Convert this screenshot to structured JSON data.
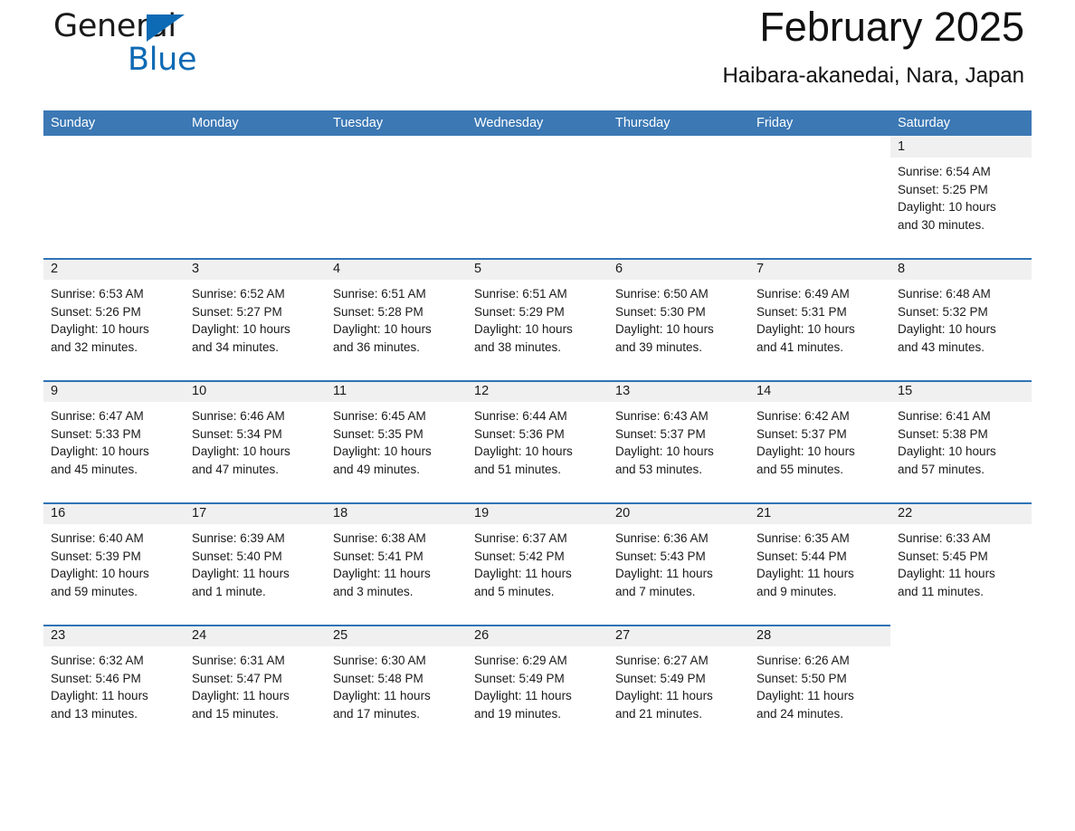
{
  "brand": {
    "word1": "General",
    "word2": "Blue",
    "triangle_color": "#0d6ab4"
  },
  "header": {
    "title": "February 2025",
    "location": "Haibara-akanedai, Nara, Japan"
  },
  "theme": {
    "header_row_bg": "#3b78b4",
    "rule_color": "#2f74b5",
    "date_bar_bg": "#f0f0f0",
    "text_color": "#1a1a1a"
  },
  "weekdays": [
    "Sunday",
    "Monday",
    "Tuesday",
    "Wednesday",
    "Thursday",
    "Friday",
    "Saturday"
  ],
  "weeks": [
    [
      {
        "blank": true
      },
      {
        "blank": true
      },
      {
        "blank": true
      },
      {
        "blank": true
      },
      {
        "blank": true
      },
      {
        "blank": true
      },
      {
        "day": "1",
        "sunrise": "Sunrise: 6:54 AM",
        "sunset": "Sunset: 5:25 PM",
        "daylight1": "Daylight: 10 hours",
        "daylight2": "and 30 minutes."
      }
    ],
    [
      {
        "day": "2",
        "sunrise": "Sunrise: 6:53 AM",
        "sunset": "Sunset: 5:26 PM",
        "daylight1": "Daylight: 10 hours",
        "daylight2": "and 32 minutes."
      },
      {
        "day": "3",
        "sunrise": "Sunrise: 6:52 AM",
        "sunset": "Sunset: 5:27 PM",
        "daylight1": "Daylight: 10 hours",
        "daylight2": "and 34 minutes."
      },
      {
        "day": "4",
        "sunrise": "Sunrise: 6:51 AM",
        "sunset": "Sunset: 5:28 PM",
        "daylight1": "Daylight: 10 hours",
        "daylight2": "and 36 minutes."
      },
      {
        "day": "5",
        "sunrise": "Sunrise: 6:51 AM",
        "sunset": "Sunset: 5:29 PM",
        "daylight1": "Daylight: 10 hours",
        "daylight2": "and 38 minutes."
      },
      {
        "day": "6",
        "sunrise": "Sunrise: 6:50 AM",
        "sunset": "Sunset: 5:30 PM",
        "daylight1": "Daylight: 10 hours",
        "daylight2": "and 39 minutes."
      },
      {
        "day": "7",
        "sunrise": "Sunrise: 6:49 AM",
        "sunset": "Sunset: 5:31 PM",
        "daylight1": "Daylight: 10 hours",
        "daylight2": "and 41 minutes."
      },
      {
        "day": "8",
        "sunrise": "Sunrise: 6:48 AM",
        "sunset": "Sunset: 5:32 PM",
        "daylight1": "Daylight: 10 hours",
        "daylight2": "and 43 minutes."
      }
    ],
    [
      {
        "day": "9",
        "sunrise": "Sunrise: 6:47 AM",
        "sunset": "Sunset: 5:33 PM",
        "daylight1": "Daylight: 10 hours",
        "daylight2": "and 45 minutes."
      },
      {
        "day": "10",
        "sunrise": "Sunrise: 6:46 AM",
        "sunset": "Sunset: 5:34 PM",
        "daylight1": "Daylight: 10 hours",
        "daylight2": "and 47 minutes."
      },
      {
        "day": "11",
        "sunrise": "Sunrise: 6:45 AM",
        "sunset": "Sunset: 5:35 PM",
        "daylight1": "Daylight: 10 hours",
        "daylight2": "and 49 minutes."
      },
      {
        "day": "12",
        "sunrise": "Sunrise: 6:44 AM",
        "sunset": "Sunset: 5:36 PM",
        "daylight1": "Daylight: 10 hours",
        "daylight2": "and 51 minutes."
      },
      {
        "day": "13",
        "sunrise": "Sunrise: 6:43 AM",
        "sunset": "Sunset: 5:37 PM",
        "daylight1": "Daylight: 10 hours",
        "daylight2": "and 53 minutes."
      },
      {
        "day": "14",
        "sunrise": "Sunrise: 6:42 AM",
        "sunset": "Sunset: 5:37 PM",
        "daylight1": "Daylight: 10 hours",
        "daylight2": "and 55 minutes."
      },
      {
        "day": "15",
        "sunrise": "Sunrise: 6:41 AM",
        "sunset": "Sunset: 5:38 PM",
        "daylight1": "Daylight: 10 hours",
        "daylight2": "and 57 minutes."
      }
    ],
    [
      {
        "day": "16",
        "sunrise": "Sunrise: 6:40 AM",
        "sunset": "Sunset: 5:39 PM",
        "daylight1": "Daylight: 10 hours",
        "daylight2": "and 59 minutes."
      },
      {
        "day": "17",
        "sunrise": "Sunrise: 6:39 AM",
        "sunset": "Sunset: 5:40 PM",
        "daylight1": "Daylight: 11 hours",
        "daylight2": "and 1 minute."
      },
      {
        "day": "18",
        "sunrise": "Sunrise: 6:38 AM",
        "sunset": "Sunset: 5:41 PM",
        "daylight1": "Daylight: 11 hours",
        "daylight2": "and 3 minutes."
      },
      {
        "day": "19",
        "sunrise": "Sunrise: 6:37 AM",
        "sunset": "Sunset: 5:42 PM",
        "daylight1": "Daylight: 11 hours",
        "daylight2": "and 5 minutes."
      },
      {
        "day": "20",
        "sunrise": "Sunrise: 6:36 AM",
        "sunset": "Sunset: 5:43 PM",
        "daylight1": "Daylight: 11 hours",
        "daylight2": "and 7 minutes."
      },
      {
        "day": "21",
        "sunrise": "Sunrise: 6:35 AM",
        "sunset": "Sunset: 5:44 PM",
        "daylight1": "Daylight: 11 hours",
        "daylight2": "and 9 minutes."
      },
      {
        "day": "22",
        "sunrise": "Sunrise: 6:33 AM",
        "sunset": "Sunset: 5:45 PM",
        "daylight1": "Daylight: 11 hours",
        "daylight2": "and 11 minutes."
      }
    ],
    [
      {
        "day": "23",
        "sunrise": "Sunrise: 6:32 AM",
        "sunset": "Sunset: 5:46 PM",
        "daylight1": "Daylight: 11 hours",
        "daylight2": "and 13 minutes."
      },
      {
        "day": "24",
        "sunrise": "Sunrise: 6:31 AM",
        "sunset": "Sunset: 5:47 PM",
        "daylight1": "Daylight: 11 hours",
        "daylight2": "and 15 minutes."
      },
      {
        "day": "25",
        "sunrise": "Sunrise: 6:30 AM",
        "sunset": "Sunset: 5:48 PM",
        "daylight1": "Daylight: 11 hours",
        "daylight2": "and 17 minutes."
      },
      {
        "day": "26",
        "sunrise": "Sunrise: 6:29 AM",
        "sunset": "Sunset: 5:49 PM",
        "daylight1": "Daylight: 11 hours",
        "daylight2": "and 19 minutes."
      },
      {
        "day": "27",
        "sunrise": "Sunrise: 6:27 AM",
        "sunset": "Sunset: 5:49 PM",
        "daylight1": "Daylight: 11 hours",
        "daylight2": "and 21 minutes."
      },
      {
        "day": "28",
        "sunrise": "Sunrise: 6:26 AM",
        "sunset": "Sunset: 5:50 PM",
        "daylight1": "Daylight: 11 hours",
        "daylight2": "and 24 minutes."
      },
      {
        "blank": true
      }
    ]
  ]
}
